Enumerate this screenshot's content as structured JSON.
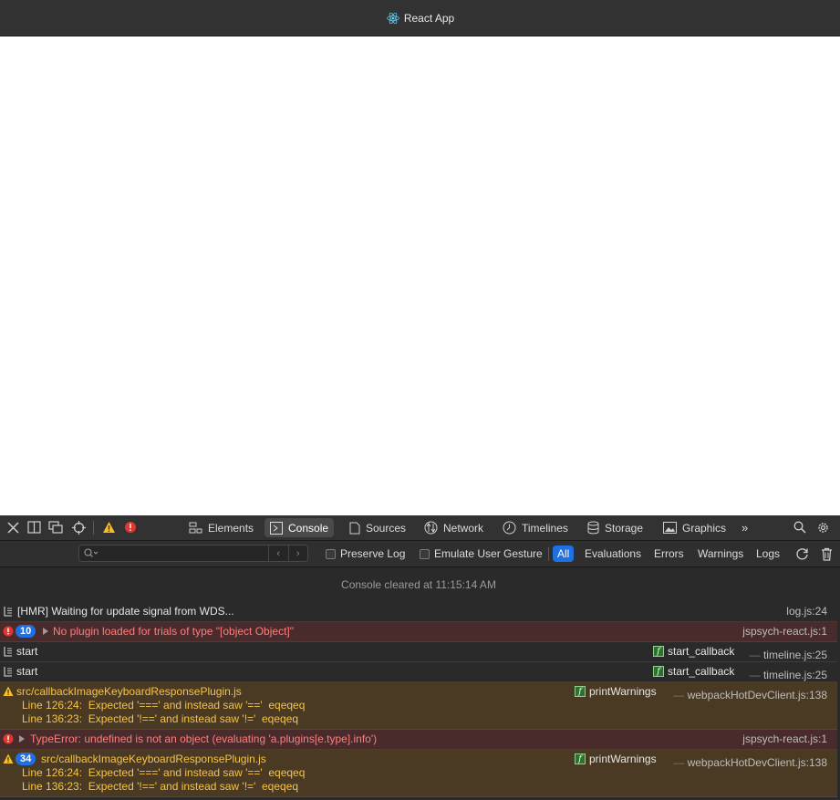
{
  "window": {
    "title": "React App"
  },
  "devtools": {
    "tabs": [
      {
        "label": "Elements",
        "icon": "elements-icon"
      },
      {
        "label": "Console",
        "icon": "console-icon",
        "active": true
      },
      {
        "label": "Sources",
        "icon": "sources-icon"
      },
      {
        "label": "Network",
        "icon": "network-icon"
      },
      {
        "label": "Timelines",
        "icon": "timelines-icon"
      },
      {
        "label": "Storage",
        "icon": "storage-icon"
      },
      {
        "label": "Graphics",
        "icon": "graphics-icon"
      }
    ],
    "more_label": "»",
    "filter": {
      "search_placeholder": "",
      "preserve_log": "Preserve Log",
      "emulate_gesture": "Emulate User Gesture",
      "levels": [
        "All",
        "Evaluations",
        "Errors",
        "Warnings",
        "Logs"
      ],
      "active_level": "All"
    },
    "console": {
      "cleared": "Console cleared at 11:15:14 AM",
      "messages": [
        {
          "type": "log",
          "text": "[HMR] Waiting for update signal from WDS...",
          "source": "log.js:24"
        },
        {
          "type": "error",
          "count": "10",
          "text": "No plugin loaded for trials of type \"[object Object]\"",
          "source": "jspsych-react.js:1"
        },
        {
          "type": "log",
          "text": "start",
          "fn": "start_callback",
          "source": "timeline.js:25"
        },
        {
          "type": "log",
          "text": "start",
          "fn": "start_callback",
          "source": "timeline.js:25"
        },
        {
          "type": "warn",
          "text": "src/callbackImageKeyboardResponsePlugin.js",
          "lines": [
            "Line 126:24:  Expected '===' and instead saw '=='  eqeqeq",
            "Line 136:23:  Expected '!==' and instead saw '!='  eqeqeq"
          ],
          "fn": "printWarnings",
          "source": "webpackHotDevClient.js:138"
        },
        {
          "type": "error",
          "text": "TypeError: undefined is not an object (evaluating 'a.plugins[e.type].info')",
          "source": "jspsych-react.js:1"
        },
        {
          "type": "warn",
          "count": "34",
          "text": "src/callbackImageKeyboardResponsePlugin.js",
          "lines": [
            "Line 126:24:  Expected '===' and instead saw '=='  eqeqeq",
            "Line 136:23:  Expected '!==' and instead saw '!='  eqeqeq"
          ],
          "fn": "printWarnings",
          "source": "webpackHotDevClient.js:138"
        }
      ]
    }
  }
}
